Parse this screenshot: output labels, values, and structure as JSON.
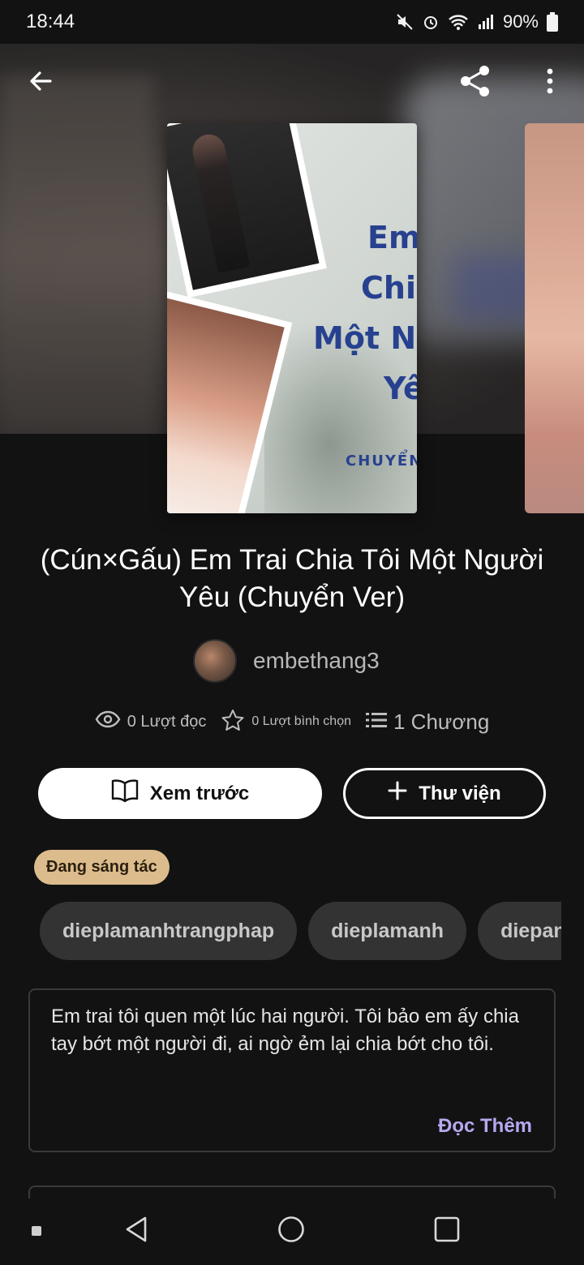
{
  "status_bar": {
    "time": "18:44",
    "battery": "90%",
    "icons": [
      "mute-icon",
      "alarm-icon",
      "wifi-icon",
      "signal-icon",
      "battery-icon"
    ]
  },
  "header": {
    "back_icon": "arrow-left-icon",
    "share_icon": "share-icon",
    "more_icon": "more-vertical-icon"
  },
  "cover": {
    "title_lines": [
      "Em T",
      "Chia",
      "Một N",
      "Yê"
    ],
    "subtitle": "CHUYỂN"
  },
  "story": {
    "title": "(Cún×Gấu) Em Trai Chia Tôi Một Người Yêu (Chuyển Ver)",
    "author": "embethang3",
    "reads": "0 Lượt đọc",
    "votes": "0 Lượt bình chọn",
    "parts": "1 Chương"
  },
  "actions": {
    "preview_label": "Xem trước",
    "library_label": "Thư viện"
  },
  "badge": "Đang sáng tác",
  "tags": [
    "dieplamanhtrangphap",
    "dieplamanh",
    "diepanh"
  ],
  "description": {
    "text": "Em trai tôi quen một lúc hai người. Tôi bảo em ấy chia tay bớt một người đi, ai ngờ ẻm lại chia bớt cho tôi.",
    "read_more": "Đọc Thêm"
  },
  "colors": {
    "background": "#121212",
    "accent_read_more": "#b8a8f0",
    "badge_bg": "#dcbc8c",
    "tag_bg": "#333333"
  }
}
